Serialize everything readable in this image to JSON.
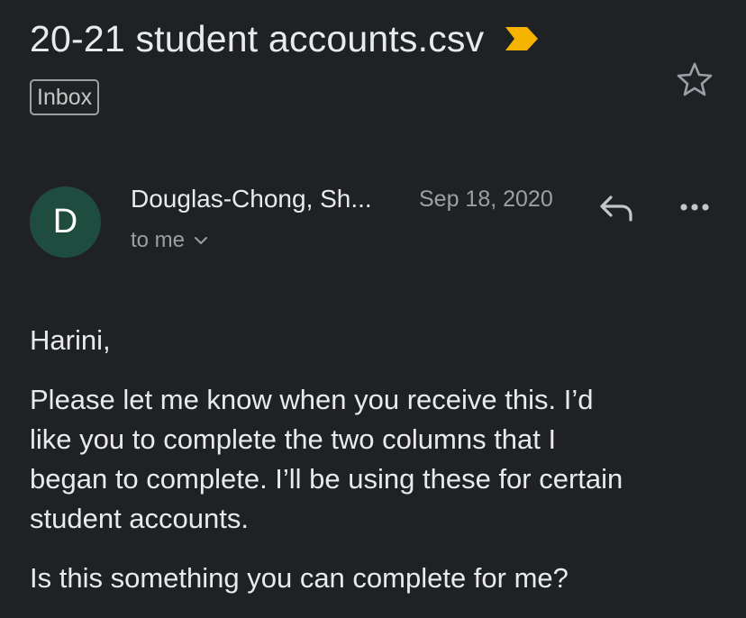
{
  "email": {
    "subject": "20-21 student accounts.csv",
    "label": "Inbox",
    "sender": {
      "avatar_letter": "D",
      "name": "Douglas-Chong, Sh...",
      "date": "Sep 18, 2020",
      "recipients": "to me"
    },
    "body": {
      "greeting": "Harini,",
      "paragraph1_line1": "Please let me know when you receive this.  I’d",
      "paragraph1_line2": "like you to complete the two columns that I",
      "paragraph1_line3": "began to complete.  I’ll be using these for certain",
      "paragraph1_line4": "student accounts.",
      "paragraph2_partial": "Is this something you can complete for me?"
    }
  },
  "colors": {
    "background": "#202124",
    "importance_marker": "#f4b400",
    "avatar": "#1e4d40",
    "secondary_text": "#9aa0a6"
  },
  "icons": {
    "importance": "importance-marker-icon",
    "star": "star-icon",
    "reply": "reply-icon",
    "more": "more-options-icon",
    "expand": "chevron-down-icon"
  }
}
